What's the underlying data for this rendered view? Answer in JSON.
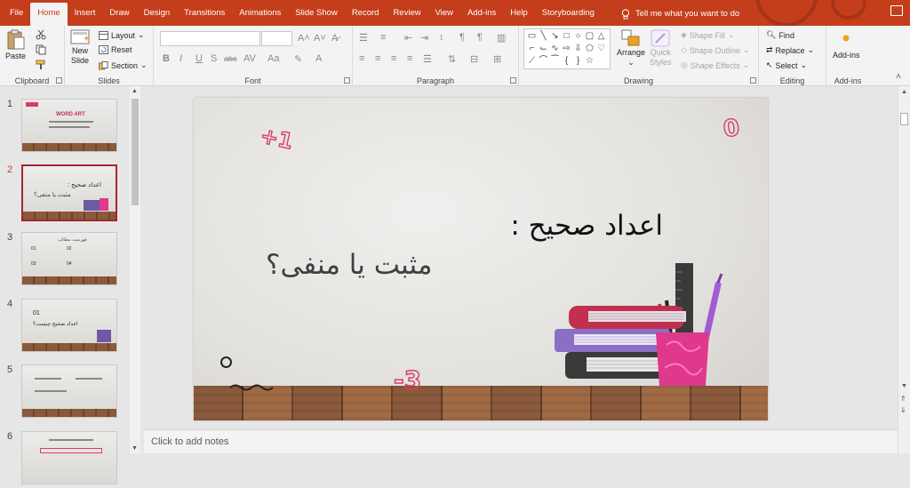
{
  "tabs": [
    "File",
    "Home",
    "Insert",
    "Draw",
    "Design",
    "Transitions",
    "Animations",
    "Slide Show",
    "Record",
    "Review",
    "View",
    "Add-ins",
    "Help",
    "Storyboarding"
  ],
  "tell_me": "Tell me what you want to do",
  "groups": {
    "clipboard": {
      "label": "Clipboard",
      "paste": "Paste"
    },
    "slides": {
      "label": "Slides",
      "new_slide_1": "New",
      "new_slide_2": "Slide",
      "layout": "Layout",
      "reset": "Reset",
      "section": "Section"
    },
    "font": {
      "label": "Font"
    },
    "paragraph": {
      "label": "Paragraph"
    },
    "drawing": {
      "label": "Drawing",
      "arrange": "Arrange",
      "quick_styles_1": "Quick",
      "quick_styles_2": "Styles",
      "shape_fill": "Shape Fill",
      "shape_outline": "Shape Outline",
      "shape_effects": "Shape Effects"
    },
    "editing": {
      "label": "Editing",
      "find": "Find",
      "replace": "Replace",
      "select": "Select"
    },
    "addins": {
      "label": "Add-ins",
      "addins_btn": "Add-ins"
    }
  },
  "thumbnails": [
    {
      "num": "1",
      "title": "WORD ART"
    },
    {
      "num": "2",
      "title": "اعداد صحیح :",
      "subtitle": "مثبت یا منفی؟"
    },
    {
      "num": "3",
      "title": "فهرست مطالب",
      "items": [
        "01",
        "02",
        "03",
        "04"
      ]
    },
    {
      "num": "4",
      "num_label": "01",
      "title": "اعداد صحیح چیست؟"
    },
    {
      "num": "5"
    },
    {
      "num": "6"
    }
  ],
  "slide": {
    "title": "اعداد صحیح :",
    "subtitle": "مثبت یا منفی؟",
    "doodles": {
      "plus_one": "+1",
      "zero": "0",
      "minus_three": "-3"
    }
  },
  "notes_placeholder": "Click to add notes",
  "colors": {
    "accent": "#c43e1c",
    "selected_thumb_border": "#a4262c",
    "doodle": "#d63f63"
  }
}
